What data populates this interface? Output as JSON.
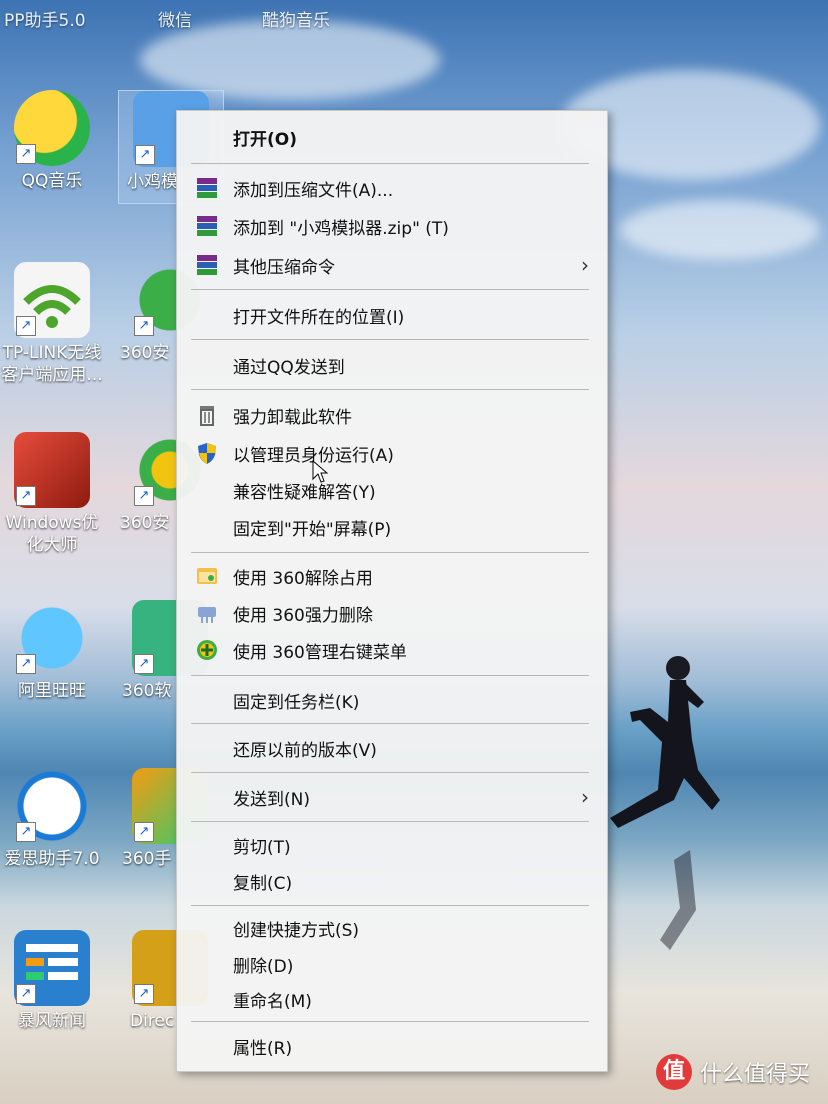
{
  "taskbar_labels": [
    "PP助手5.0",
    "微信",
    "酷狗音乐"
  ],
  "desktop_icons": [
    {
      "label": "QQ音乐",
      "icon": "qq-music-icon",
      "color": "#2ab34b"
    },
    {
      "label": "小鸡模",
      "icon": "chick-emulator-icon",
      "color": "#f1c40f"
    },
    {
      "label": "TP-LINK无线\n客户端应用...",
      "icon": "tp-link-wifi-icon",
      "color": "#56b03a"
    },
    {
      "label": "360安",
      "icon": "360-security-icon",
      "color": "#2fa84f"
    },
    {
      "label": "Windows优\n化大师",
      "icon": "windows-optimizer-icon",
      "color": "#c0392b"
    },
    {
      "label": "360安",
      "icon": "360-guard-icon",
      "color": "#3cae48"
    },
    {
      "label": "阿里旺旺",
      "icon": "aliwangwang-icon",
      "color": "#2c9be3"
    },
    {
      "label": "360软",
      "icon": "360-software-icon",
      "color": "#36b37e"
    },
    {
      "label": "爱思助手7.0",
      "icon": "i4-assistant-icon",
      "color": "#1a7ad6"
    },
    {
      "label": "360手",
      "icon": "360-phone-icon",
      "color": "#f39c12"
    },
    {
      "label": "暴风新闻",
      "icon": "baofeng-news-icon",
      "color": "#2a7fcf"
    },
    {
      "label": "Direc",
      "icon": "directx-icon",
      "color": "#d4a017"
    }
  ],
  "context_menu": {
    "open": "打开(O)",
    "add_archive": "添加到压缩文件(A)...",
    "add_zip": "添加到 \"小鸡模拟器.zip\" (T)",
    "other_compress": "其他压缩命令",
    "open_location": "打开文件所在的位置(I)",
    "send_qq": "通过QQ发送到",
    "force_uninstall": "强力卸载此软件",
    "run_admin": "以管理员身份运行(A)",
    "compat": "兼容性疑难解答(Y)",
    "pin_start": "固定到\"开始\"屏幕(P)",
    "use_360_unlock": "使用 360解除占用",
    "use_360_delete": "使用 360强力删除",
    "use_360_menu": "使用 360管理右键菜单",
    "pin_taskbar": "固定到任务栏(K)",
    "restore_versions": "还原以前的版本(V)",
    "send_to": "发送到(N)",
    "cut": "剪切(T)",
    "copy": "复制(C)",
    "create_shortcut": "创建快捷方式(S)",
    "delete": "删除(D)",
    "rename": "重命名(M)",
    "properties": "属性(R)"
  },
  "watermark": {
    "badge": "值",
    "text": "什么值得买"
  },
  "colors": {
    "menu_bg": "#f4f4f4",
    "separator": "#b8b8b8",
    "text": "#111111"
  }
}
